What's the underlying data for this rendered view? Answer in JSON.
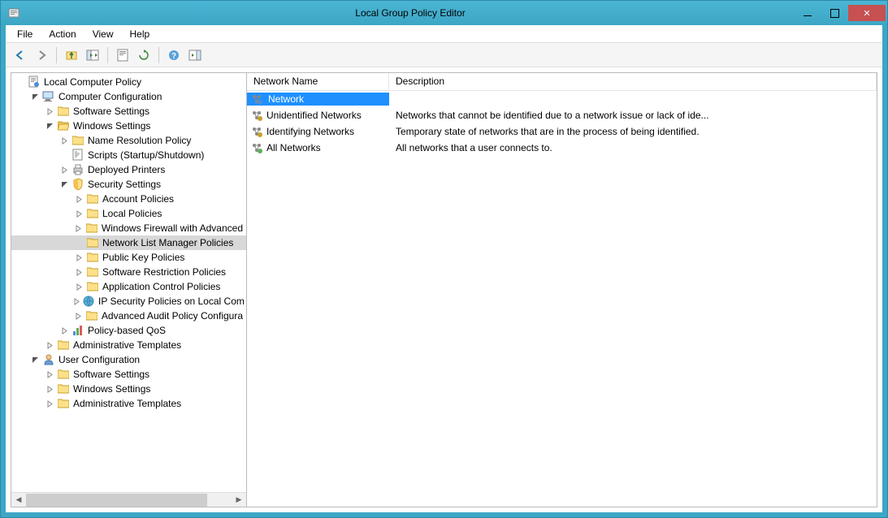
{
  "window": {
    "title": "Local Group Policy Editor"
  },
  "menu": {
    "file": "File",
    "action": "Action",
    "view": "View",
    "help": "Help"
  },
  "toolbar": {
    "back": "back",
    "forward": "forward",
    "up": "up",
    "properties": "properties",
    "refresh": "refresh",
    "export": "export",
    "help": "help",
    "show_hide": "show-hide"
  },
  "tree": {
    "root": "Local Computer Policy",
    "computer_config": "Computer Configuration",
    "cc_software": "Software Settings",
    "cc_windows": "Windows Settings",
    "ws_name_res": "Name Resolution Policy",
    "ws_scripts": "Scripts (Startup/Shutdown)",
    "ws_printers": "Deployed Printers",
    "ws_security": "Security Settings",
    "sec_account": "Account Policies",
    "sec_local": "Local Policies",
    "sec_firewall": "Windows Firewall with Advanced",
    "sec_netlist": "Network List Manager Policies",
    "sec_pubkey": "Public Key Policies",
    "sec_softrest": "Software Restriction Policies",
    "sec_appctrl": "Application Control Policies",
    "sec_ipsec": "IP Security Policies on Local Com",
    "sec_advaudit": "Advanced Audit Policy Configura",
    "ws_qos": "Policy-based QoS",
    "cc_admin": "Administrative Templates",
    "user_config": "User Configuration",
    "uc_software": "Software Settings",
    "uc_windows": "Windows Settings",
    "uc_admin": "Administrative Templates"
  },
  "list": {
    "col_name": "Network Name",
    "col_desc": "Description",
    "rows": [
      {
        "name": "Network",
        "desc": ""
      },
      {
        "name": "Unidentified Networks",
        "desc": "Networks that cannot be identified due to a network issue or lack of ide..."
      },
      {
        "name": "Identifying Networks",
        "desc": "Temporary state of networks that are in the process of being identified."
      },
      {
        "name": "All Networks",
        "desc": "All networks that a user connects to."
      }
    ]
  }
}
